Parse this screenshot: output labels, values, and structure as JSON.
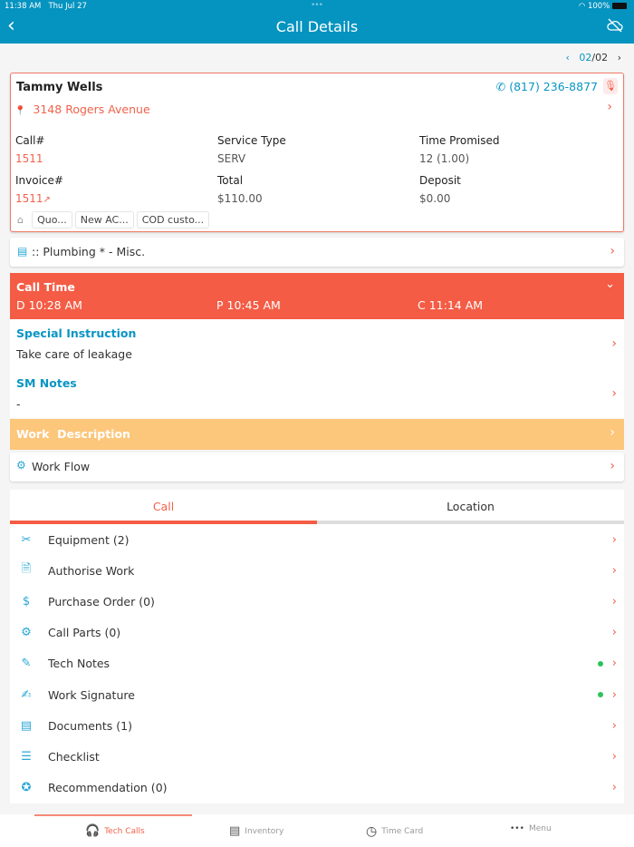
{
  "status": {
    "time": "11:38 AM",
    "date": "Thu Jul 27",
    "battery": "100%"
  },
  "header": {
    "title": "Call Details"
  },
  "pager": {
    "current": "02",
    "total": "/02"
  },
  "customer": {
    "name": "Tammy Wells",
    "phone": "(817) 236-8877",
    "address": "3148 Rogers Avenue"
  },
  "fields": {
    "call_label": "Call#",
    "call_value": "1511",
    "service_label": "Service Type",
    "service_value": "SERV",
    "time_label": "Time Promised",
    "time_value": "12 (1.00)",
    "invoice_label": "Invoice#",
    "invoice_value": "1511",
    "total_label": "Total",
    "total_value": "$110.00",
    "deposit_label": "Deposit",
    "deposit_value": "$0.00"
  },
  "tags": [
    "Quo...",
    "New AC...",
    "COD custo..."
  ],
  "category": ":: Plumbing * - Misc.",
  "call_time": {
    "title": "Call Time",
    "d": "D 10:28 AM",
    "p": "P 10:45 AM",
    "c": "C 11:14 AM"
  },
  "special": {
    "title": "Special Instruction",
    "text": "Take care of leakage"
  },
  "sm_notes": {
    "title": "SM Notes",
    "text": "-"
  },
  "work_description": "Work  Description",
  "work_flow": "Work Flow",
  "tabs": [
    "Call",
    "Location"
  ],
  "accent": "#f45c45",
  "items": [
    {
      "label": "Equipment (2)",
      "icon": "tools-icon"
    },
    {
      "label": "Authorise Work",
      "icon": "document-check-icon"
    },
    {
      "label": "Purchase Order (0)",
      "icon": "receipt-icon"
    },
    {
      "label": "Call Parts (0)",
      "icon": "gear-icon"
    },
    {
      "label": "Tech Notes",
      "icon": "notes-icon"
    },
    {
      "label": "Work Signature",
      "icon": "signature-icon"
    },
    {
      "label": "Documents (1)",
      "icon": "documents-icon"
    },
    {
      "label": "Checklist",
      "icon": "checklist-icon"
    },
    {
      "label": "Recommendation (0)",
      "icon": "award-icon"
    }
  ],
  "nav": [
    "Tech Calls",
    "Inventory",
    "Time Card",
    "Menu"
  ]
}
